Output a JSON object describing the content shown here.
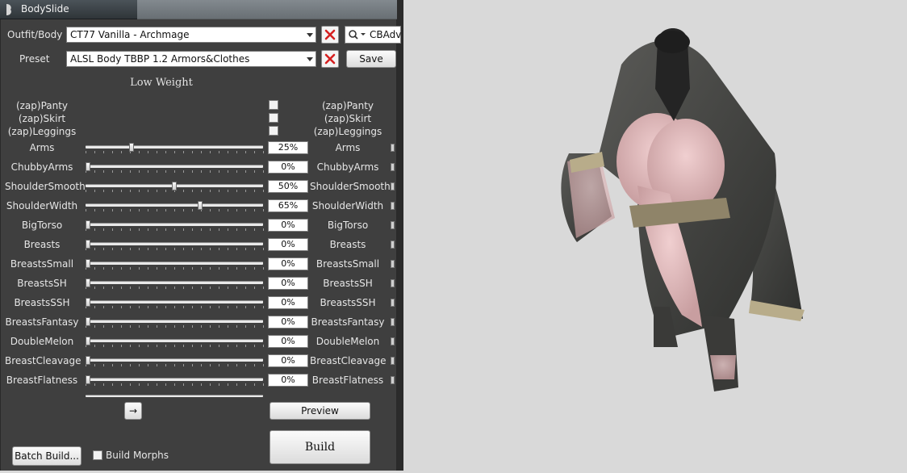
{
  "window": {
    "title": "BodySlide"
  },
  "outfit": {
    "label": "Outfit/Body",
    "value": "CT77 Vanilla - Archmage"
  },
  "preset": {
    "label": "Preset",
    "value": "ALSL Body TBBP 1.2 Armors&Clothes",
    "save_label": "Save"
  },
  "filter": {
    "value": "CBAdv"
  },
  "section": {
    "title": "Low Weight"
  },
  "zaps": [
    {
      "label": "(zap)Panty"
    },
    {
      "label": "(zap)Skirt"
    },
    {
      "label": "(zap)Leggings"
    }
  ],
  "sliders": [
    {
      "label": "Arms",
      "value": "25%",
      "fraction": 0.25
    },
    {
      "label": "ChubbyArms",
      "value": "0%",
      "fraction": 0
    },
    {
      "label": "ShoulderSmooth",
      "value": "50%",
      "fraction": 0.5
    },
    {
      "label": "ShoulderWidth",
      "value": "65%",
      "fraction": 0.65
    },
    {
      "label": "BigTorso",
      "value": "0%",
      "fraction": 0
    },
    {
      "label": "Breasts",
      "value": "0%",
      "fraction": 0
    },
    {
      "label": "BreastsSmall",
      "value": "0%",
      "fraction": 0
    },
    {
      "label": "BreastsSH",
      "value": "0%",
      "fraction": 0
    },
    {
      "label": "BreastsSSH",
      "value": "0%",
      "fraction": 0
    },
    {
      "label": "BreastsFantasy",
      "value": "0%",
      "fraction": 0
    },
    {
      "label": "DoubleMelon",
      "value": "0%",
      "fraction": 0
    },
    {
      "label": "BreastCleavage",
      "value": "0%",
      "fraction": 0
    },
    {
      "label": "BreastFlatness",
      "value": "0%",
      "fraction": 0
    }
  ],
  "buttons": {
    "arrow": "→",
    "preview": "Preview",
    "build": "Build",
    "batch_build": "Batch Build...",
    "build_morphs": "Build Morphs"
  },
  "colors": {
    "panel": "#3f3f3f",
    "viewport": "#d9d9d9",
    "clear_x": "#d62020"
  }
}
